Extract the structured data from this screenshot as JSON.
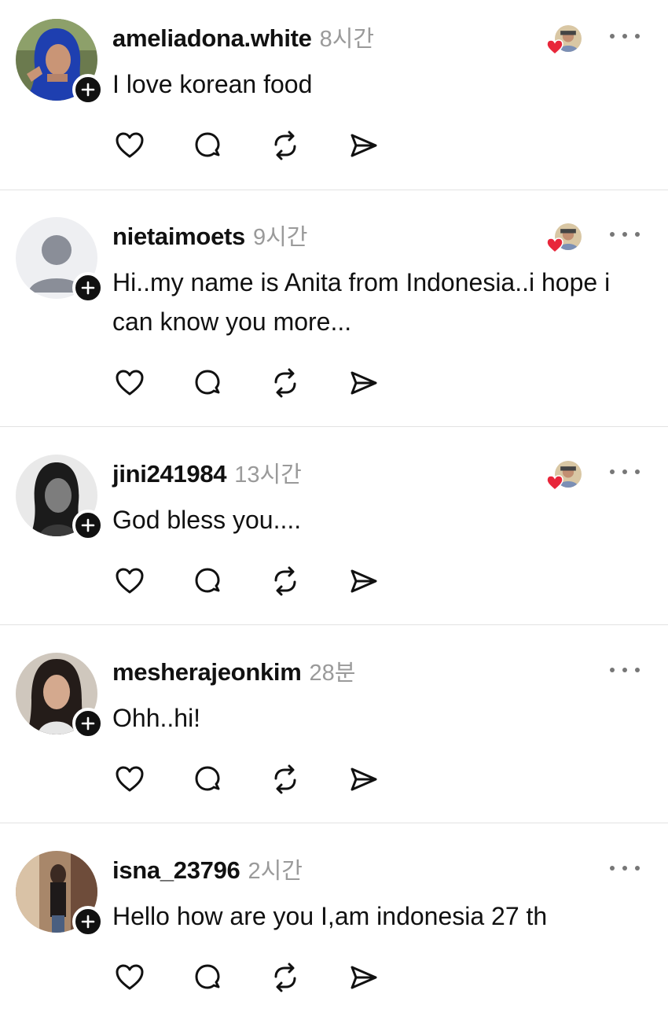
{
  "posts": [
    {
      "username": "ameliadona.white",
      "time": "8시간",
      "text": "I love korean food",
      "has_liked_by": true,
      "avatar": "hijab-woman-photo"
    },
    {
      "username": "nietaimoets",
      "time": "9시간",
      "text": "Hi..my name is Anita from Indonesia..i hope i can know you more...",
      "has_liked_by": true,
      "avatar": "default-avatar"
    },
    {
      "username": "jini241984",
      "time": "13시간",
      "text": "God bless you....",
      "has_liked_by": true,
      "avatar": "bw-woman-photo"
    },
    {
      "username": "mesherajeonkim",
      "time": "28분",
      "text": "Ohh..hi!",
      "has_liked_by": false,
      "avatar": "selfie-photo"
    },
    {
      "username": "isna_23796",
      "time": "2시간",
      "text": "Hello how are you I,am indonesia 27 th",
      "has_liked_by": false,
      "avatar": "mirror-selfie-photo"
    }
  ],
  "icons": {
    "like": "heart-outline-icon",
    "reply": "speech-bubble-icon",
    "repost": "repost-arrows-icon",
    "share": "paper-plane-icon",
    "more": "ellipsis-icon",
    "follow": "plus-icon"
  },
  "colors": {
    "text": "#111111",
    "muted": "#9a9a9a",
    "divider": "#e2e2e2",
    "heart": "#e8263a"
  }
}
